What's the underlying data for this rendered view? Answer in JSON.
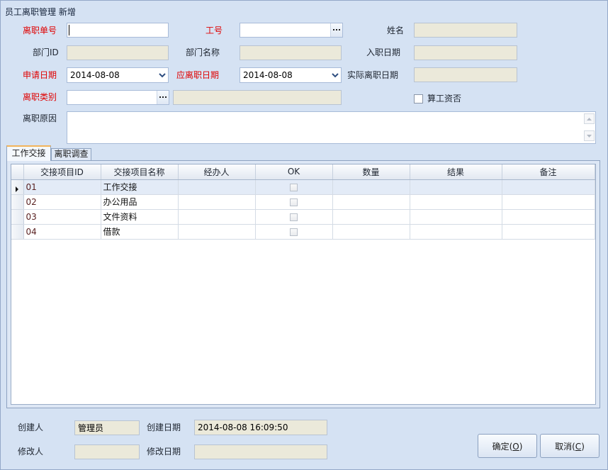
{
  "window": {
    "title": "员工离职管理 新增"
  },
  "colors": {
    "background": "#d5e2f3",
    "required_label": "#e00000",
    "disabled_field": "#ebe9da",
    "input_border": "#a8bbd8",
    "selected_row": "#e3ebf7",
    "tab_page": "#dde7f5"
  },
  "form": {
    "resign_no": {
      "label": "离职单号",
      "value": "",
      "required": true
    },
    "emp_no": {
      "label": "工号",
      "value": "",
      "required": true,
      "lookup_icon": "ellipsis-icon"
    },
    "name": {
      "label": "姓名",
      "value": "",
      "enabled": false
    },
    "dept_id": {
      "label": "部门ID",
      "value": "",
      "enabled": false
    },
    "dept_name": {
      "label": "部门名称",
      "value": "",
      "enabled": false
    },
    "hire_date": {
      "label": "入职日期",
      "value": "",
      "enabled": false
    },
    "apply_date": {
      "label": "申请日期",
      "value": "2014-08-08",
      "required": true,
      "dropdown_icon": "chevron-down-icon"
    },
    "due_date": {
      "label": "应离职日期",
      "value": "2014-08-08",
      "required": true,
      "dropdown_icon": "chevron-down-icon"
    },
    "actual_date": {
      "label": "实际离职日期",
      "value": "",
      "enabled": false
    },
    "category": {
      "label": "离职类别",
      "value": "",
      "description": "",
      "required": true,
      "lookup_icon": "ellipsis-icon"
    },
    "calc_salary": {
      "label": "算工资否",
      "checked": false
    },
    "reason": {
      "label": "离职原因",
      "value": ""
    }
  },
  "tabs": [
    {
      "label": "工作交接",
      "active": true
    },
    {
      "label": "离职调查",
      "active": false
    }
  ],
  "grid": {
    "columns": [
      "交接项目ID",
      "交接项目名称",
      "经办人",
      "OK",
      "数量",
      "结果",
      "备注"
    ],
    "selected_row": 0,
    "rows": [
      {
        "id": "01",
        "name": "工作交接",
        "handler": "",
        "ok": false,
        "quantity": "",
        "result": "",
        "remark": ""
      },
      {
        "id": "02",
        "name": "办公用品",
        "handler": "",
        "ok": false,
        "quantity": "",
        "result": "",
        "remark": ""
      },
      {
        "id": "03",
        "name": "文件资料",
        "handler": "",
        "ok": false,
        "quantity": "",
        "result": "",
        "remark": ""
      },
      {
        "id": "04",
        "name": "借款",
        "handler": "",
        "ok": false,
        "quantity": "",
        "result": "",
        "remark": ""
      }
    ]
  },
  "footer": {
    "creator": {
      "label": "创建人",
      "value": "管理员"
    },
    "create_date": {
      "label": "创建日期",
      "value": "2014-08-08 16:09:50"
    },
    "modifier": {
      "label": "修改人",
      "value": ""
    },
    "modify_date": {
      "label": "修改日期",
      "value": ""
    }
  },
  "buttons": {
    "confirm": {
      "prefix": "确定(",
      "mnemonic": "O",
      "suffix": ")"
    },
    "cancel": {
      "prefix": "取消(",
      "mnemonic": "C",
      "suffix": ")"
    }
  }
}
